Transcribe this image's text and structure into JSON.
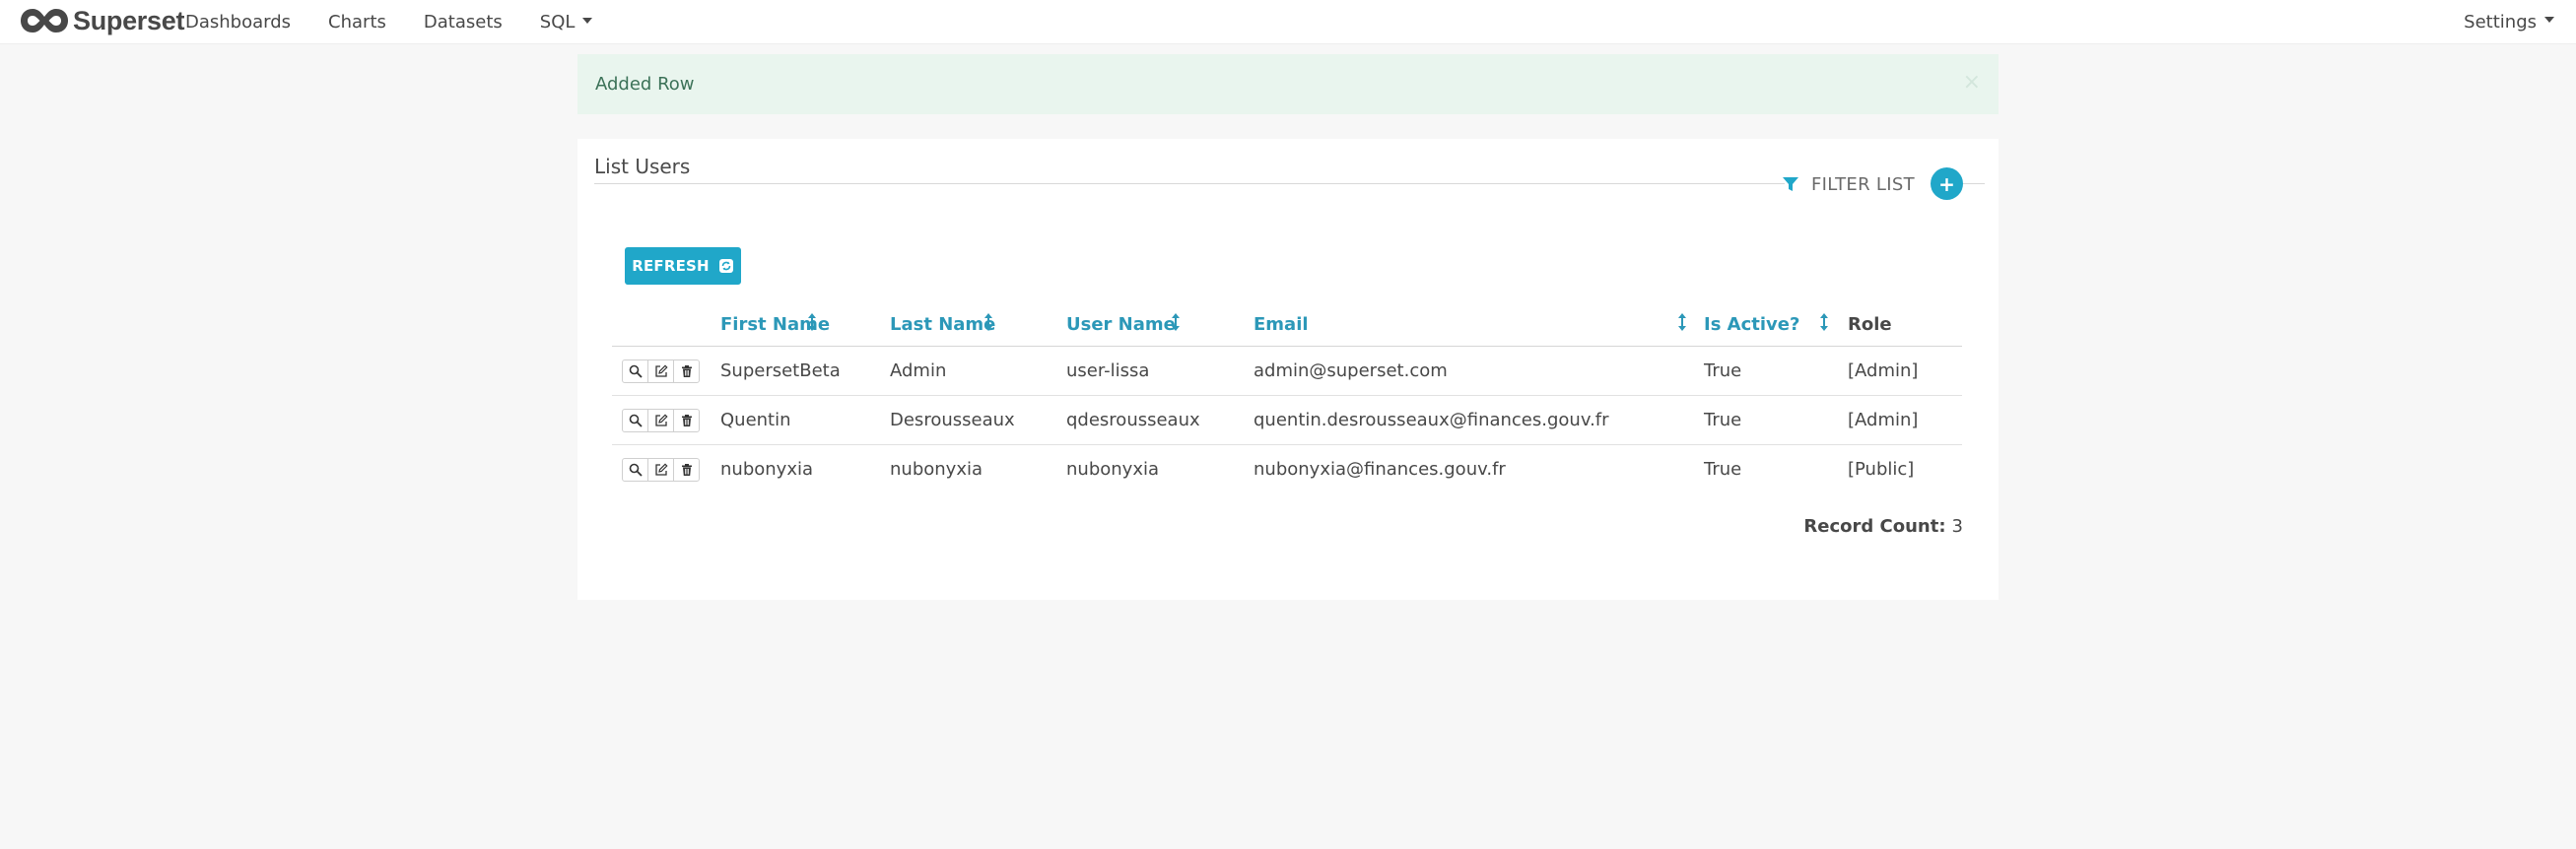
{
  "navbar": {
    "brand": "Superset",
    "links": [
      "Dashboards",
      "Charts",
      "Datasets",
      "SQL"
    ],
    "settings": "Settings"
  },
  "flash": {
    "message": "Added Row",
    "close": "×"
  },
  "panel": {
    "title": "List Users",
    "filter_label": "FILTER LIST",
    "add_label": "+",
    "refresh_label": "REFRESH"
  },
  "table": {
    "columns": [
      "First Name",
      "Last Name",
      "User Name",
      "Email",
      "Is Active?",
      "Role"
    ],
    "rows": [
      [
        "SupersetBeta",
        "Admin",
        "user-lissa",
        "admin@superset.com",
        "True",
        "[Admin]"
      ],
      [
        "Quentin",
        "Desrousseaux",
        "qdesrousseaux",
        "quentin.desrousseaux@finances.gouv.fr",
        "True",
        "[Admin]"
      ],
      [
        "nubonyxia",
        "nubonyxia",
        "nubonyxia",
        "nubonyxia@finances.gouv.fr",
        "True",
        "[Public]"
      ]
    ],
    "record_count_label": "Record Count:",
    "record_count_value": "3"
  },
  "colors": {
    "accent": "#20a7c9",
    "link": "#2c98b8",
    "flash_bg": "#e9f5ee",
    "flash_text": "#3c7258"
  },
  "icons": {
    "logo": "superset-infinity-logo",
    "filter": "filter-icon",
    "refresh": "refresh-icon",
    "sort": "sort-icon",
    "show": "search-icon",
    "edit": "edit-icon",
    "delete": "trash-icon"
  }
}
